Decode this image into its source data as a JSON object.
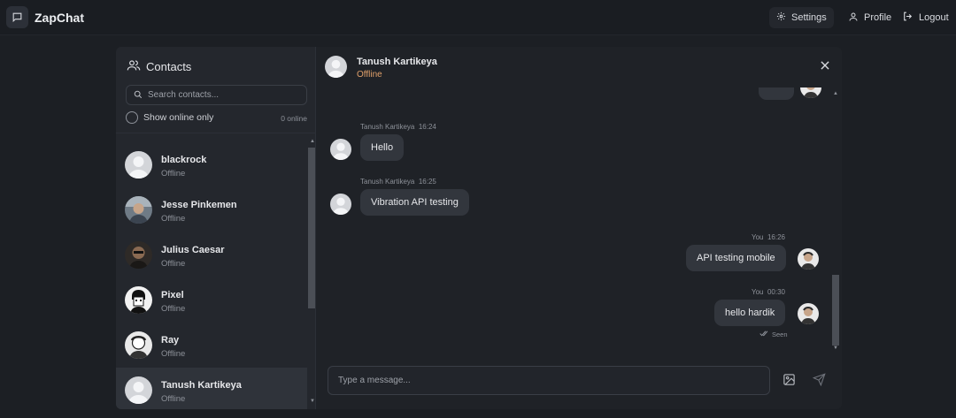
{
  "app": {
    "brand": "ZapChat",
    "settings_label": "Settings",
    "profile_label": "Profile",
    "logout_label": "Logout"
  },
  "sidebar": {
    "title": "Contacts",
    "search_placeholder": "Search contacts...",
    "online_only_label": "Show online only",
    "online_count": "0 online",
    "contacts": [
      {
        "name": "blackrock",
        "status": "Offline",
        "avatar": "default"
      },
      {
        "name": "Jesse Pinkemen",
        "status": "Offline",
        "avatar": "photo"
      },
      {
        "name": "Julius Caesar",
        "status": "Offline",
        "avatar": "photo"
      },
      {
        "name": "Pixel",
        "status": "Offline",
        "avatar": "photo"
      },
      {
        "name": "Ray",
        "status": "Offline",
        "avatar": "photo"
      },
      {
        "name": "Tanush Kartikeya",
        "status": "Offline",
        "avatar": "default"
      }
    ]
  },
  "chat": {
    "header": {
      "name": "Tanush Kartikeya",
      "status": "Offline"
    },
    "messages": [
      {
        "sender": "Tanush Kartikeya",
        "time": "16:24",
        "text": "Hello",
        "side": "left"
      },
      {
        "sender": "Tanush Kartikeya",
        "time": "16:25",
        "text": "Vibration API testing",
        "side": "left"
      },
      {
        "sender": "You",
        "time": "16:26",
        "text": "API testing mobile",
        "side": "right"
      },
      {
        "sender": "You",
        "time": "00:30",
        "text": "hello hardik",
        "side": "right"
      }
    ],
    "seen_label": "Seen",
    "composer_placeholder": "Type a message..."
  },
  "colors": {
    "background": "#1c1f24",
    "panel": "#24272d",
    "bubble": "#32363d",
    "offline_status": "#e0a06a"
  },
  "icons": {
    "logo": "chat-bubble-icon",
    "settings": "gear-icon",
    "profile": "user-icon",
    "logout": "logout-icon",
    "contacts": "users-icon",
    "search": "search-icon",
    "close": "close-icon",
    "image": "image-icon",
    "send": "send-icon"
  }
}
